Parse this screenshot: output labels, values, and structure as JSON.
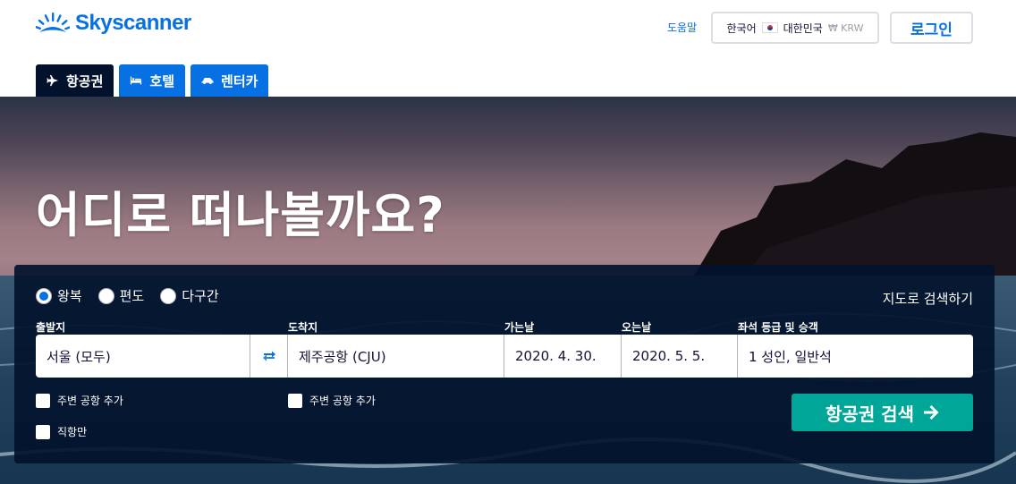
{
  "header": {
    "brand": "Skyscanner",
    "help_label": "도움말",
    "locale": {
      "language": "한국어",
      "country": "대한민국",
      "currency": "₩ KRW"
    },
    "login_label": "로그인"
  },
  "tabs": [
    {
      "label": "항공권",
      "icon": "airplane-icon",
      "active": true
    },
    {
      "label": "호텔",
      "icon": "bed-icon",
      "active": false
    },
    {
      "label": "렌터카",
      "icon": "car-icon",
      "active": false
    }
  ],
  "hero": {
    "title": "어디로 떠나볼까요?"
  },
  "search": {
    "trip_types": [
      {
        "label": "왕복",
        "checked": true
      },
      {
        "label": "편도",
        "checked": false
      },
      {
        "label": "다구간",
        "checked": false
      }
    ],
    "map_search_label": "지도로 검색하기",
    "labels": {
      "from": "출발지",
      "to": "도착지",
      "depart": "가는날",
      "return": "오는날",
      "cabin": "좌석 등급 및 승객"
    },
    "values": {
      "from": "서울 (모두)",
      "to": "제주공항 (CJU)",
      "depart": "2020. 4. 30.",
      "return": "2020. 5. 5.",
      "cabin": "1 성인, 일반석"
    },
    "nearby_from_label": "주변 공항 추가",
    "nearby_to_label": "주변 공항 추가",
    "direct_only_label": "직항만",
    "submit_label": "항공권 검색"
  },
  "colors": {
    "brand": "#0770e3",
    "dark": "#02122c",
    "cta": "#00a698"
  }
}
